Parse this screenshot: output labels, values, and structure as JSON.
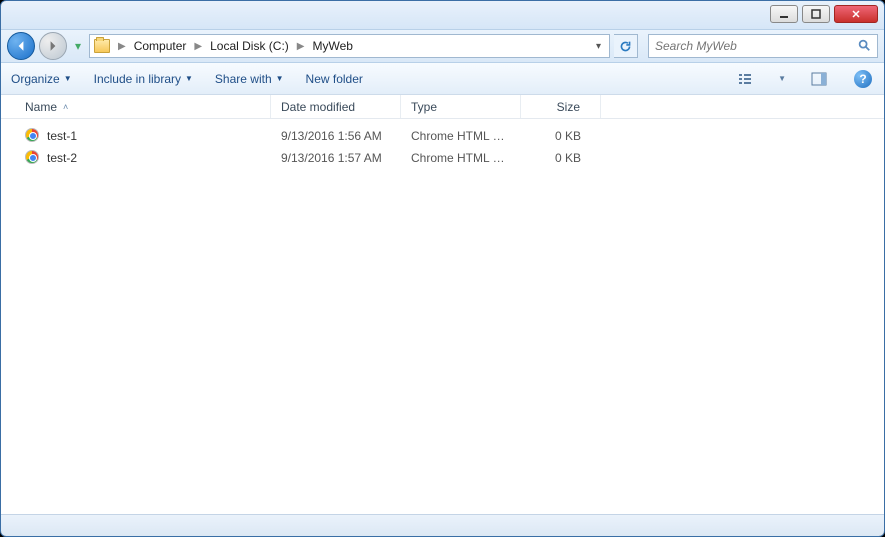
{
  "breadcrumb": {
    "items": [
      "Computer",
      "Local Disk (C:)",
      "MyWeb"
    ]
  },
  "search": {
    "placeholder": "Search MyWeb"
  },
  "toolbar": {
    "organize": "Organize",
    "include": "Include in library",
    "share": "Share with",
    "newfolder": "New folder"
  },
  "columns": {
    "name": "Name",
    "date": "Date modified",
    "type": "Type",
    "size": "Size"
  },
  "files": [
    {
      "name": "test-1",
      "date": "9/13/2016 1:56 AM",
      "type": "Chrome HTML Do...",
      "size": "0 KB"
    },
    {
      "name": "test-2",
      "date": "9/13/2016 1:57 AM",
      "type": "Chrome HTML Do...",
      "size": "0 KB"
    }
  ]
}
